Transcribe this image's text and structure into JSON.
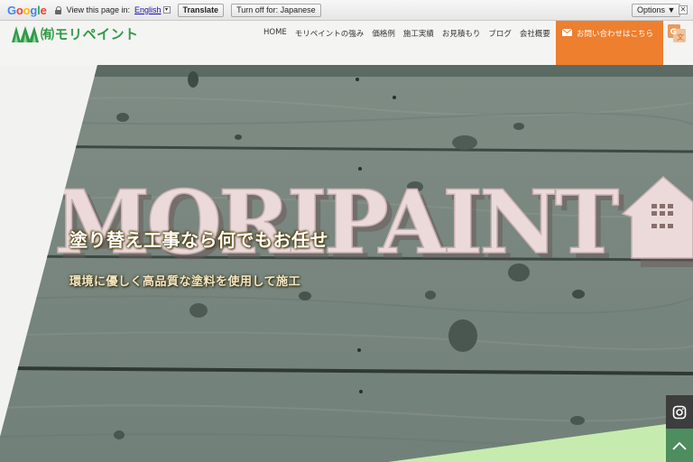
{
  "translate_bar": {
    "logo": "Google",
    "prompt": "View this page in:",
    "language": "English",
    "translate_label": "Translate",
    "turn_off_label": "Turn off for: Japanese",
    "options_label": "Options ▼",
    "close_label": "✕"
  },
  "site": {
    "logo_text": "㈲モリペイント",
    "nav": [
      "HOME",
      "モリペイントの強み",
      "価格例",
      "施工実績",
      "お見積もり",
      "ブログ",
      "会社概要"
    ],
    "contact_label": "お問い合わせはこちら"
  },
  "hero": {
    "sign_text": "MORIPAINT",
    "headline": "塗り替え工事なら何でもお任せ",
    "subline": "環境に優しく高品質な塗料を使用して施工"
  },
  "colors": {
    "brand_green": "#2f9a46",
    "contact_orange": "#ed7f2e",
    "wood_gray": "#7c8a82",
    "back_to_top_green": "#4e8d5e"
  },
  "icons": {
    "instagram": "instagram-icon",
    "back_to_top": "chevron-up-icon",
    "mail": "mail-icon",
    "translate": "google-translate-icon"
  }
}
